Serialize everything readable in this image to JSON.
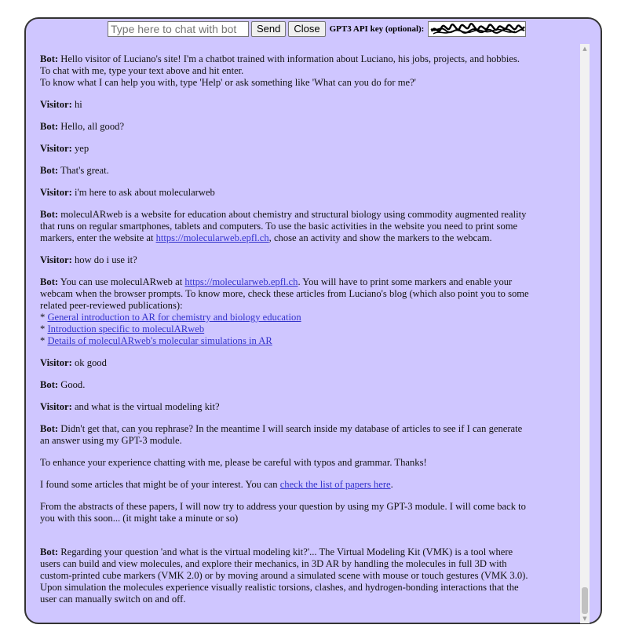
{
  "topbar": {
    "chat_placeholder": "Type here to chat with bot",
    "send_label": "Send",
    "close_label": "Close",
    "api_label": "GPT3 API key (optional):"
  },
  "messages": {
    "m1": {
      "speaker": "Bot:",
      "l1": " Hello visitor of Luciano's site! I'm a chatbot trained with information about Luciano, his jobs, projects, and hobbies. To chat with me, type your text above and hit enter.",
      "l2": "To know what I can help you with, type 'Help' or ask something like 'What can you do for me?'"
    },
    "m2": {
      "speaker": "Visitor:",
      "text": " hi"
    },
    "m3": {
      "speaker": "Bot:",
      "text": " Hello, all good?"
    },
    "m4": {
      "speaker": "Visitor:",
      "text": " yep"
    },
    "m5": {
      "speaker": "Bot:",
      "text": " That's great."
    },
    "m6": {
      "speaker": "Visitor:",
      "text": " i'm here to ask about molecularweb"
    },
    "m7": {
      "speaker": "Bot:",
      "pre": " moleculARweb is a website for education about chemistry and structural biology using commodity augmented reality that runs on regular smartphones, tablets and computers. To use the basic activities in the website you need to print some markers, enter the website at ",
      "link": "https://molecularweb.epfl.ch",
      "post": ", chose an activity and show the markers to the webcam."
    },
    "m8": {
      "speaker": "Visitor:",
      "text": " how do i use it?"
    },
    "m9": {
      "speaker": "Bot:",
      "pre": " You can use moleculARweb at ",
      "link": "https://molecularweb.epfl.ch",
      "post": ". You will have to print some markers and enable your webcam when the browser prompts. To know more, check these articles from Luciano's blog (which also point you to some related peer-reviewed publications):",
      "bullet": "* ",
      "link1": "General introduction to AR for chemistry and biology education",
      "link2": "Introduction specific to moleculARweb",
      "link3": "Details of moleculARweb's molecular simulations in AR"
    },
    "m10": {
      "speaker": "Visitor:",
      "text": " ok good"
    },
    "m11": {
      "speaker": "Bot:",
      "text": " Good."
    },
    "m12": {
      "speaker": "Visitor:",
      "text": " and what is the virtual modeling kit?"
    },
    "m13": {
      "speaker": "Bot:",
      "text": " Didn't get that, can you rephrase? In the meantime I will search inside my database of articles to see if I can generate an answer using my GPT-3 module."
    },
    "m14": {
      "text": "To enhance your experience chatting with me, please be careful with typos and grammar. Thanks!"
    },
    "m15": {
      "pre": "I found some articles that might be of your interest. You can ",
      "link": "check the list of papers here",
      "post": "."
    },
    "m16": {
      "text": "From the abstracts of these papers, I will now try to address your question by using my GPT-3 module. I will come back to you with this soon... (it might take a minute or so)"
    },
    "m17": {
      "speaker": "Bot:",
      "text": " Regarding your question 'and what is the virtual modeling kit?'... The Virtual Modeling Kit (VMK) is a tool where users can build and view molecules, and explore their mechanics, in 3D AR by handling the molecules in full 3D with custom-printed cube markers (VMK 2.0) or by moving around a simulated scene with mouse or touch gestures (VMK 3.0). Upon simulation the molecules experience visually realistic torsions, clashes, and hydrogen-bonding interactions that the user can manually switch on and off."
    }
  },
  "colors": {
    "panel_background": "#cfc6ff",
    "link": "#3333cc",
    "scroll_thumb": "#c1c1c1"
  },
  "icons": {
    "scroll_up": "triangle-up-icon",
    "scroll_down": "triangle-down-icon"
  }
}
